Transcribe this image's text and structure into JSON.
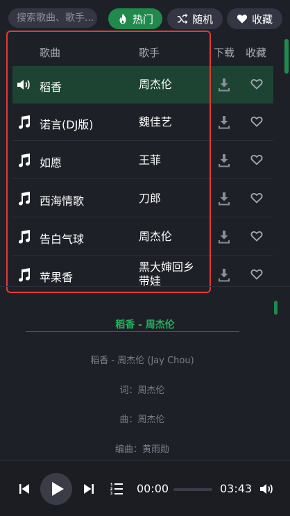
{
  "search": {
    "placeholder": "搜索歌曲、歌手..."
  },
  "filters": {
    "hot": "热门",
    "random": "随机",
    "favorites": "收藏"
  },
  "table": {
    "headers": {
      "song": "歌曲",
      "artist": "歌手",
      "download": "下载",
      "favorite": "收藏"
    },
    "rows": [
      {
        "song": "稻香",
        "artist": "周杰伦",
        "playing": true
      },
      {
        "song": "诺言(DJ版)",
        "artist": "魏佳艺",
        "playing": false
      },
      {
        "song": "如愿",
        "artist": "王菲",
        "playing": false
      },
      {
        "song": "西海情歌",
        "artist": "刀郎",
        "playing": false
      },
      {
        "song": "告白气球",
        "artist": "周杰伦",
        "playing": false
      },
      {
        "song": "苹果香",
        "artist_line1": "黑大婶回乡",
        "artist_line2": "带娃",
        "playing": false
      }
    ]
  },
  "lyrics": {
    "title": "稻香 - 周杰伦",
    "lines": [
      "稻香 - 周杰伦 (Jay Chou)",
      "词：周杰伦",
      "曲：周杰伦",
      "编曲：黄雨勋"
    ]
  },
  "player": {
    "current_time": "00:00",
    "duration": "03:43",
    "progress": 0
  },
  "colors": {
    "accent": "#1f8a4c",
    "active_row": "#1d4432",
    "highlight": "#e53935",
    "background": "#1e2027"
  },
  "icons": {
    "hot": "flame-icon",
    "random": "shuffle-icon",
    "favorites": "heart-icon",
    "playing": "speaker-icon",
    "song": "music-note-icon",
    "download": "download-icon",
    "favorite": "heart-outline-icon"
  }
}
